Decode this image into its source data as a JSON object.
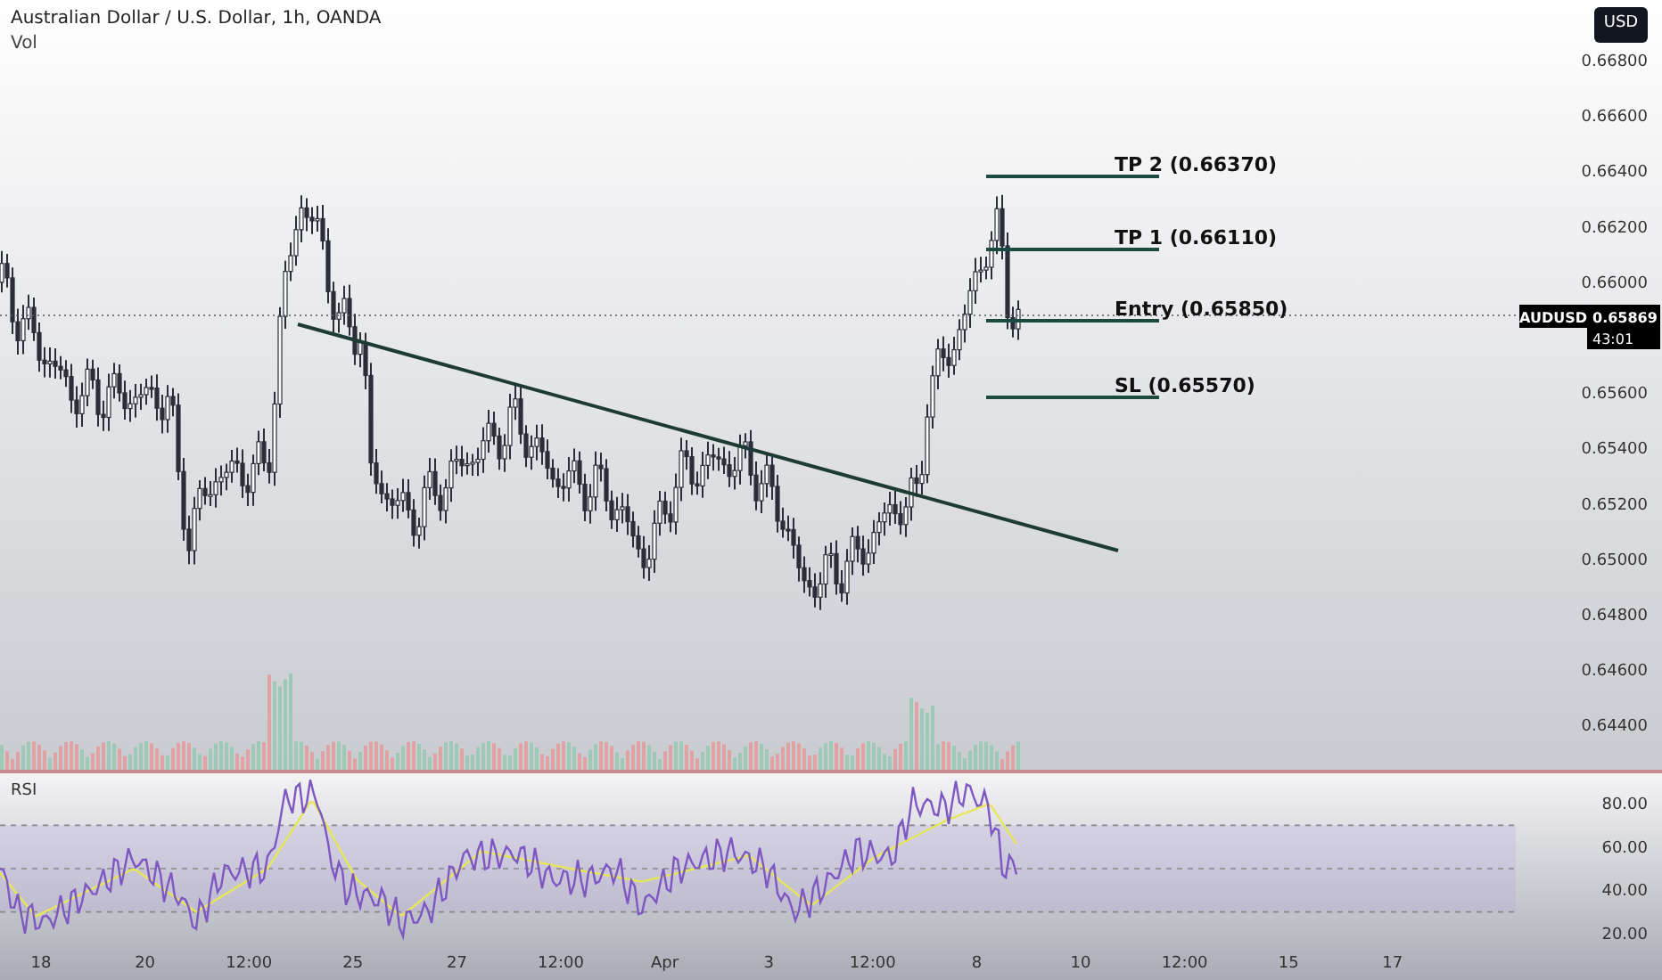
{
  "header": {
    "title": "Australian Dollar / U.S. Dollar, 1h, OANDA",
    "indicator": "Vol"
  },
  "currency_button": "USD",
  "price_axis": [
    "0.66800",
    "0.66600",
    "0.66400",
    "0.66200",
    "0.66000",
    "0.65600",
    "0.65400",
    "0.65200",
    "0.65000",
    "0.64800",
    "0.64600",
    "0.64400"
  ],
  "price_label": {
    "symbol": "AUDUSD",
    "price": "0.65869",
    "countdown": "43:01"
  },
  "levels": [
    {
      "label": "TP 2 (0.66370)"
    },
    {
      "label": "TP 1 (0.66110)"
    },
    {
      "label": "Entry (0.65850)"
    },
    {
      "label": "SL (0.65570)"
    }
  ],
  "rsi": {
    "label": "RSI",
    "ticks": [
      "80.00",
      "60.00",
      "40.00",
      "20.00"
    ]
  },
  "time_axis": [
    "18",
    "20",
    "12:00",
    "25",
    "27",
    "12:00",
    "Apr",
    "3",
    "12:00",
    "8",
    "10",
    "12:00",
    "15",
    "17"
  ]
}
